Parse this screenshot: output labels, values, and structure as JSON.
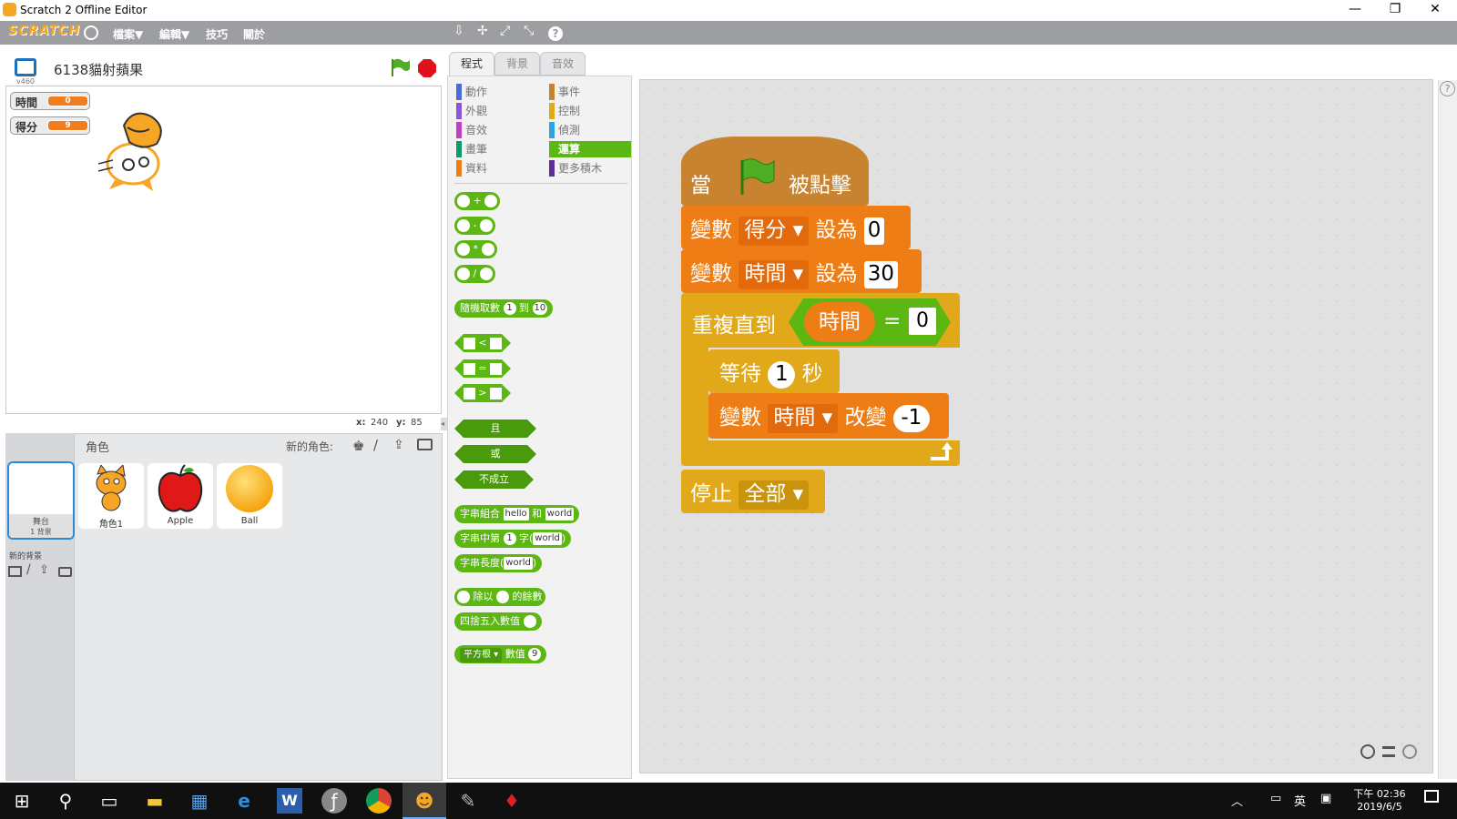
{
  "window": {
    "title": "Scratch 2 Offline Editor",
    "minimize": "—",
    "restore": "❐",
    "close": "✕"
  },
  "menubar": {
    "logo": "SCRATCH",
    "items": [
      "檔案▼",
      "編輯▼",
      "技巧",
      "關於"
    ],
    "tools": [
      "⇩",
      "✢",
      "⤢",
      "⤡",
      "?"
    ]
  },
  "stage": {
    "version": "v460",
    "project_title": "6138貓射蘋果",
    "monitors": [
      {
        "label": "時間",
        "value": "0"
      },
      {
        "label": "得分",
        "value": "9"
      }
    ],
    "coords": {
      "x_label": "x:",
      "x": "240",
      "y_label": "y:",
      "y": "85"
    }
  },
  "sprites_pane": {
    "header": "角色",
    "new_sprite": "新的角色:",
    "stage_label": "舞台",
    "stage_sub": "1 背景",
    "new_backdrop": "新的背景",
    "sprites": [
      {
        "name": "角色1"
      },
      {
        "name": "Apple"
      },
      {
        "name": "Ball"
      }
    ]
  },
  "tabs": [
    "程式",
    "背景",
    "音效"
  ],
  "categories_left": [
    {
      "label": "動作",
      "color": "#4a6cd4"
    },
    {
      "label": "外觀",
      "color": "#8a55d7"
    },
    {
      "label": "音效",
      "color": "#bb42c3"
    },
    {
      "label": "畫筆",
      "color": "#0e9a6c"
    },
    {
      "label": "資料",
      "color": "#ee7d16"
    }
  ],
  "categories_right": [
    {
      "label": "事件",
      "color": "#c88330"
    },
    {
      "label": "控制",
      "color": "#e1a91a"
    },
    {
      "label": "偵測",
      "color": "#2ca5e2"
    },
    {
      "label": "運算",
      "color": "#5cb712"
    },
    {
      "label": "更多積木",
      "color": "#632d99"
    }
  ],
  "palette": {
    "ops": [
      "+",
      "-",
      "*",
      "/"
    ],
    "random": {
      "label": "隨機取數",
      "a": "1",
      "mid": "到",
      "b": "10"
    },
    "compare": [
      "<",
      "=",
      ">"
    ],
    "logic": [
      "且",
      "或",
      "不成立"
    ],
    "join": {
      "label": "字串組合",
      "a": "hello",
      "mid": "和",
      "b": "world"
    },
    "letter": {
      "label": "字串中第",
      "a": "1",
      "mid": "字(",
      "b": "world",
      "end": ")"
    },
    "length": {
      "label": "字串長度(",
      "a": "world",
      "end": ")"
    },
    "mod": {
      "mid": "除以",
      "end": "的餘數"
    },
    "round": {
      "label": "四捨五入數值"
    },
    "math": {
      "fn": "平方根",
      "label": "數值",
      "a": "9"
    }
  },
  "script": {
    "hat": {
      "when": "當",
      "clicked": "被點擊"
    },
    "set1": {
      "label": "變數",
      "var": "得分",
      "mid": "設為",
      "value": "0"
    },
    "set2": {
      "label": "變數",
      "var": "時間",
      "mid": "設為",
      "value": "30"
    },
    "repeat": {
      "label": "重複直到",
      "var": "時間",
      "op": "=",
      "value": "0"
    },
    "wait": {
      "label": "等待",
      "value": "1",
      "unit": "秒"
    },
    "change": {
      "label": "變數",
      "var": "時間",
      "mid": "改變",
      "value": "-1"
    },
    "stop": {
      "label": "停止",
      "option": "全部"
    }
  },
  "taskbar": {
    "ime": "英",
    "time": "下午 02:36",
    "date": "2019/6/5"
  },
  "colors": {
    "events": "#c88330",
    "data": "#ee7d16",
    "control": "#e1a91a",
    "operators": "#5cb712",
    "menubar": "#9c9ea2"
  }
}
